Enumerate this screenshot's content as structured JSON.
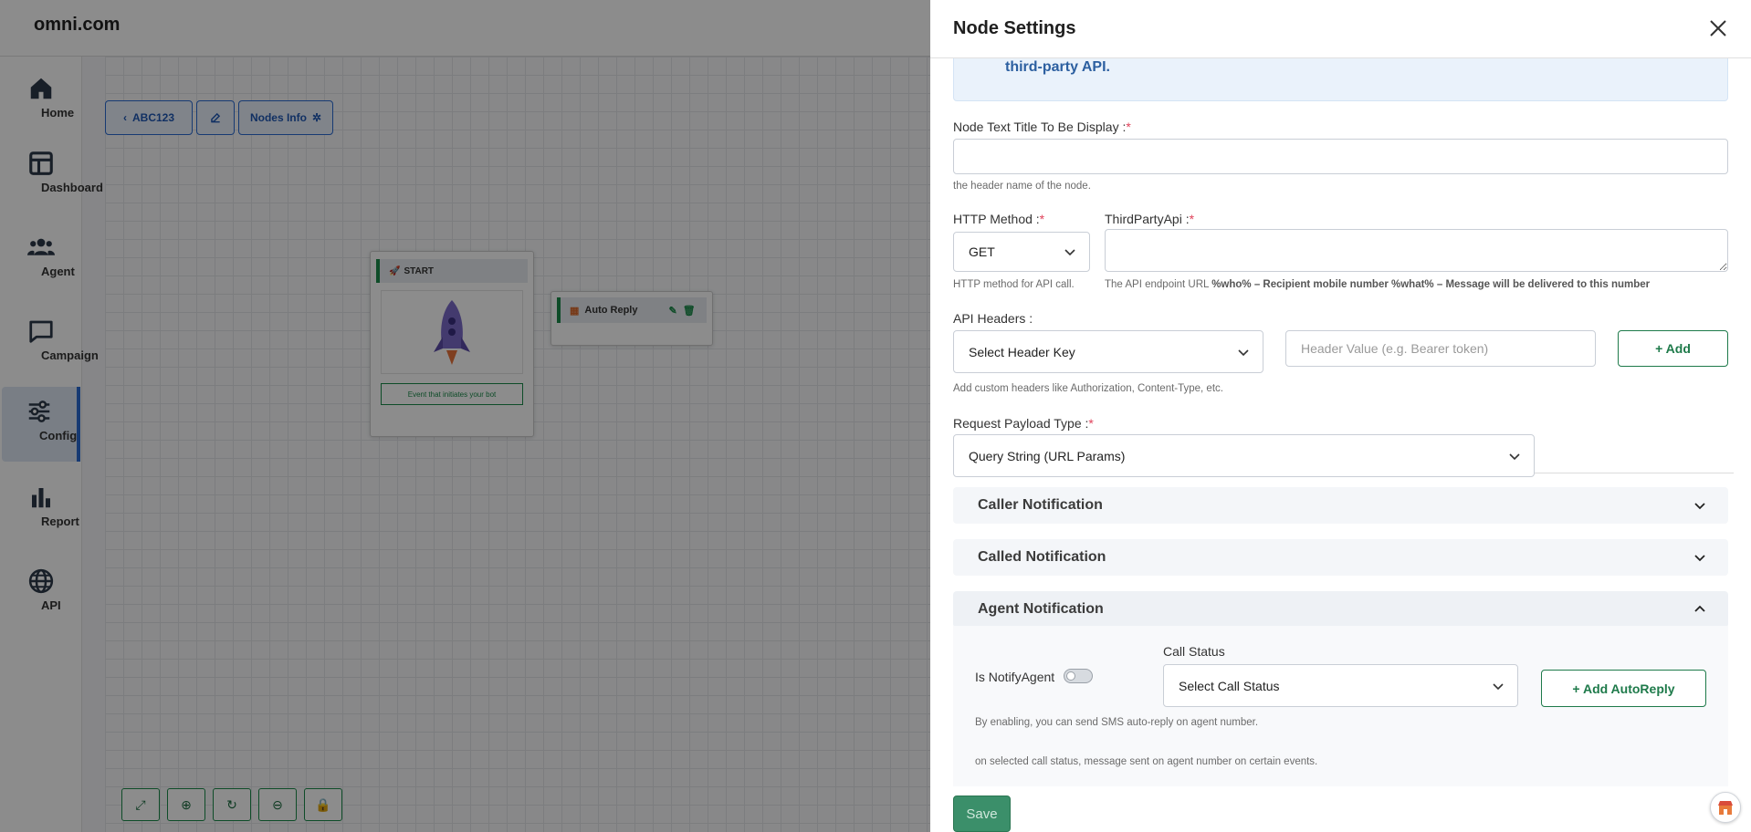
{
  "app": {
    "brand": "omni.com",
    "nav": [
      {
        "label": "Home",
        "icon": "home-icon"
      },
      {
        "label": "Dashboard",
        "icon": "dashboard-icon"
      },
      {
        "label": "Agent",
        "icon": "agents-icon"
      },
      {
        "label": "Campaign",
        "icon": "chat-icon"
      },
      {
        "label": "Config",
        "icon": "sliders-icon"
      },
      {
        "label": "Report",
        "icon": "bar-chart-icon"
      },
      {
        "label": "API",
        "icon": "globe-icon"
      }
    ],
    "toolbar": {
      "flow_name": "ABC123",
      "nodes_info": "Nodes Info"
    },
    "start_node": {
      "title": "START",
      "caption": "Event that initiates your bot"
    },
    "auto_reply_node": {
      "title": "Auto Reply"
    }
  },
  "drawer": {
    "title": "Node Settings",
    "info_text": "third-party API.",
    "node_title": {
      "label": "Node Text Title To Be Display :",
      "required": "*",
      "value": "",
      "help": "the header name of the node."
    },
    "http_method": {
      "label": "HTTP Method :",
      "required": "*",
      "value": "GET",
      "help": "HTTP method for API call."
    },
    "third_party_api": {
      "label": "ThirdPartyApi :",
      "required": "*",
      "value": "",
      "help_prefix": "The API endpoint URL ",
      "help_bold": "%who% – Recipient mobile number %what% – Message will be delivered to this number"
    },
    "api_headers": {
      "label": "API Headers :",
      "key_select": "Select Header Key",
      "value_placeholder": "Header Value (e.g. Bearer token)",
      "add_label": "+ Add",
      "help": "Add custom headers like Authorization, Content-Type, etc."
    },
    "payload_type": {
      "label": "Request Payload Type :",
      "required": "*",
      "value": "Query String (URL Params)"
    },
    "accordions": {
      "caller": "Caller Notification",
      "called": "Called Notification",
      "agent": "Agent Notification"
    },
    "agent_notification": {
      "notify_label": "Is NotifyAgent",
      "notify_on": false,
      "call_status_label": "Call Status",
      "call_status_select": "Select Call Status",
      "add_autoreply": "+ Add AutoReply",
      "help1": "By enabling, you can send SMS auto-reply on agent number.",
      "help2": "on selected call status, message sent on agent number on certain events."
    },
    "save_label": "Save"
  }
}
